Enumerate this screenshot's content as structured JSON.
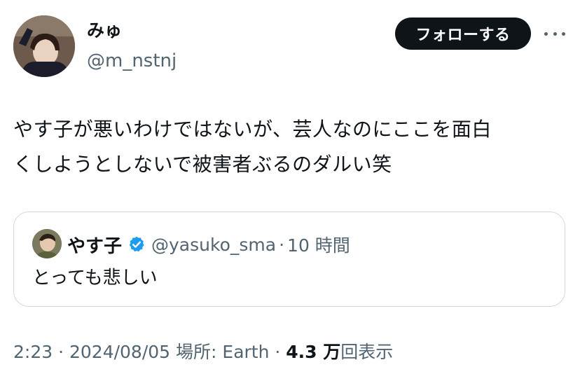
{
  "author": {
    "name": "みゅ",
    "handle": "@m_nstnj"
  },
  "actions": {
    "follow_label": "フォローする",
    "more_icon": "more-horizontal-icon"
  },
  "tweet": {
    "text_line1": "やす子が悪いわけではないが、芸人なのにここを面白",
    "text_line2": "くしようとしないで被害者ぶるのダルい笑"
  },
  "quote": {
    "name": "やす子",
    "verified_icon": "verified-badge-icon",
    "verified_color": "#1d9bf0",
    "handle": "@yasuko_sma",
    "separator": "·",
    "time": "10 時間",
    "text": "とっても悲しい"
  },
  "meta": {
    "time": "2:23",
    "sep1": " · ",
    "date": "2024/08/05",
    "location": " 場所: Earth",
    "sep2": " · ",
    "views_count": "4.3 万",
    "views_label": "回表示"
  }
}
